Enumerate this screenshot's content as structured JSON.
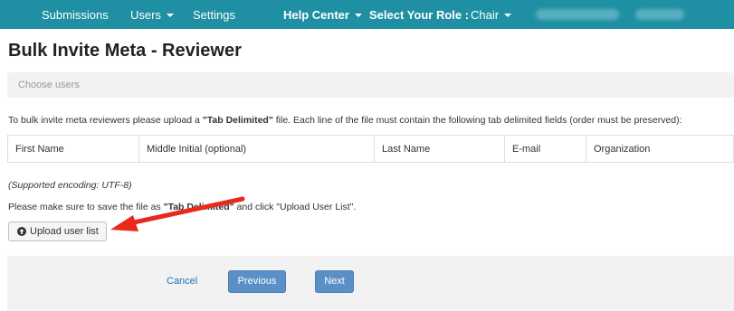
{
  "nav": {
    "submissions": "Submissions",
    "users": "Users",
    "settings": "Settings",
    "help_center": "Help Center",
    "select_role_label": "Select Your Role :",
    "role": "Chair"
  },
  "page_title": "Bulk Invite Meta - Reviewer",
  "breadcrumb": {
    "step": "Choose users"
  },
  "instructions": {
    "intro_before": "To bulk invite meta reviewers please upload a ",
    "intro_bold": "\"Tab Delimited\"",
    "intro_after": " file. Each line of the file must contain the following tab delimited fields (order must be preserved):",
    "encoding": "(Supported encoding: UTF-8)",
    "save_before": "Please make sure to save the file as ",
    "save_bold": "\"Tab Delimited\"",
    "save_after": " and click \"Upload User List\"."
  },
  "fields": [
    "First Name",
    "Middle Initial (optional)",
    "Last Name",
    "E-mail",
    "Organization"
  ],
  "upload_button": {
    "label": "Upload user list",
    "icon": "circle-arrow-up-icon"
  },
  "footer": {
    "cancel": "Cancel",
    "previous": "Previous",
    "next": "Next"
  },
  "colors": {
    "navbar": "#1f8fa3",
    "primary_button": "#5b8fc7",
    "link": "#1f72b0",
    "annotation_arrow": "#e8291c"
  }
}
